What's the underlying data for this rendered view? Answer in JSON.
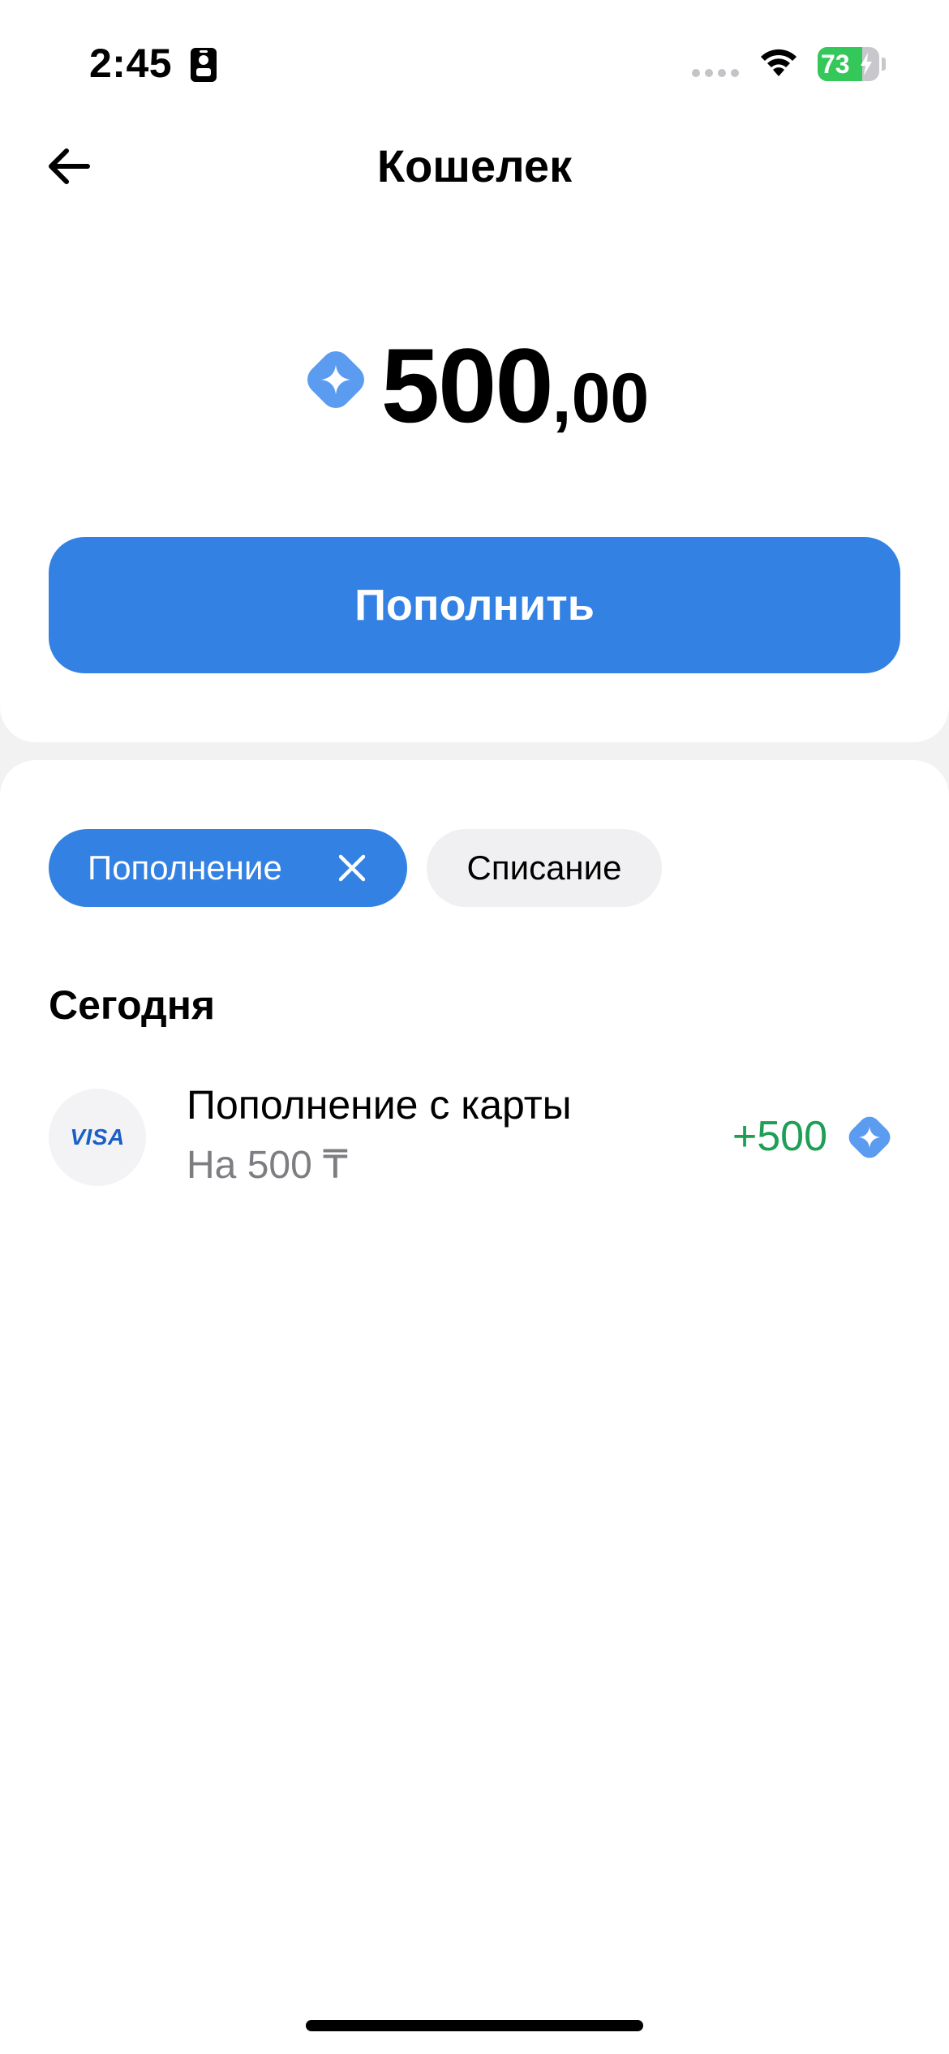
{
  "status_bar": {
    "time": "2:45",
    "battery_level": "73",
    "battery_fraction": 0.73,
    "icons": [
      "badge-icon",
      "signal-icon",
      "wifi-icon",
      "battery-icon",
      "charging-bolt-icon"
    ]
  },
  "nav": {
    "back_icon": "arrow-left-icon",
    "title": "Кошелек"
  },
  "balance": {
    "coin_icon": "wallet-coin-icon",
    "integer": "500",
    "fraction": ",00"
  },
  "topup_button": {
    "label": "Пополнить"
  },
  "filters": {
    "active": {
      "label": "Пополнение",
      "close_icon": "close-icon"
    },
    "inactive": {
      "label": "Списание"
    }
  },
  "history": {
    "section_title": "Сегодня",
    "transactions": [
      {
        "logo": "VISA",
        "title": "Пополнение с карты",
        "subtitle": "На 500 ₸",
        "amount": "+500",
        "coin_icon": "wallet-coin-icon"
      }
    ]
  },
  "colors": {
    "accent": "#3382E3",
    "coin": "#5B9CF0",
    "positive": "#1F9E55",
    "battery_green": "#34C759",
    "secondary_text": "#7D7D82"
  }
}
